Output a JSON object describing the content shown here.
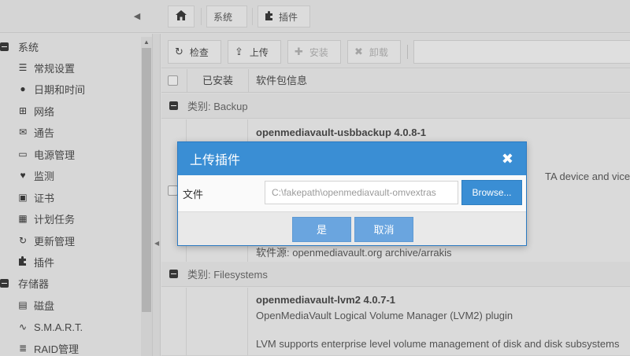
{
  "topbar": {
    "crumbs": [
      {
        "label": ""
      },
      {
        "label": "系统"
      },
      {
        "label": "插件"
      }
    ]
  },
  "sidebar": {
    "sections": [
      {
        "label": "系统"
      },
      {
        "label": "存储器"
      }
    ],
    "items": [
      {
        "label": "常规设置",
        "icon": "sliders-icon"
      },
      {
        "label": "日期和时间",
        "icon": "clock-icon"
      },
      {
        "label": "网络",
        "icon": "network-icon"
      },
      {
        "label": "通告",
        "icon": "envelope-icon"
      },
      {
        "label": "电源管理",
        "icon": "battery-icon"
      },
      {
        "label": "监测",
        "icon": "heartbeat-icon"
      },
      {
        "label": "证书",
        "icon": "certificate-icon"
      },
      {
        "label": "计划任务",
        "icon": "calendar-icon"
      },
      {
        "label": "更新管理",
        "icon": "refresh-icon"
      },
      {
        "label": "插件",
        "icon": "puzzle-icon"
      },
      {
        "label": "磁盘",
        "icon": "disk-icon"
      },
      {
        "label": "S.M.A.R.T.",
        "icon": "pulse-icon"
      },
      {
        "label": "RAID管理",
        "icon": "database-icon"
      }
    ]
  },
  "toolbar": {
    "check_label": "检查",
    "upload_label": "上传",
    "install_label": "安装",
    "remove_label": "卸载"
  },
  "grid": {
    "columns": [
      "已安装",
      "软件包信息"
    ],
    "groups": [
      {
        "label": "类别: Backup"
      },
      {
        "label": "类别: Filesystems"
      }
    ],
    "rows": [
      {
        "name": "openmediavault-usbbackup 4.0.8-1",
        "desc_fragment": "TA device and vice vers",
        "source": "软件源: openmediavault.org archive/arrakis"
      },
      {
        "name": "openmediavault-lvm2 4.0.7-1",
        "summary": "OpenMediaVault Logical Volume Manager (LVM2) plugin",
        "detail": "LVM supports enterprise level volume management of disk and disk subsystems"
      }
    ]
  },
  "modal": {
    "title": "上传插件",
    "file_label": "文件",
    "file_value": "C:\\fakepath\\openmediavault-omvextras",
    "browse_label": "Browse...",
    "yes_label": "是",
    "cancel_label": "取消"
  },
  "colors": {
    "accent": "#3a8ed4",
    "button_light": "#6aa5df"
  }
}
